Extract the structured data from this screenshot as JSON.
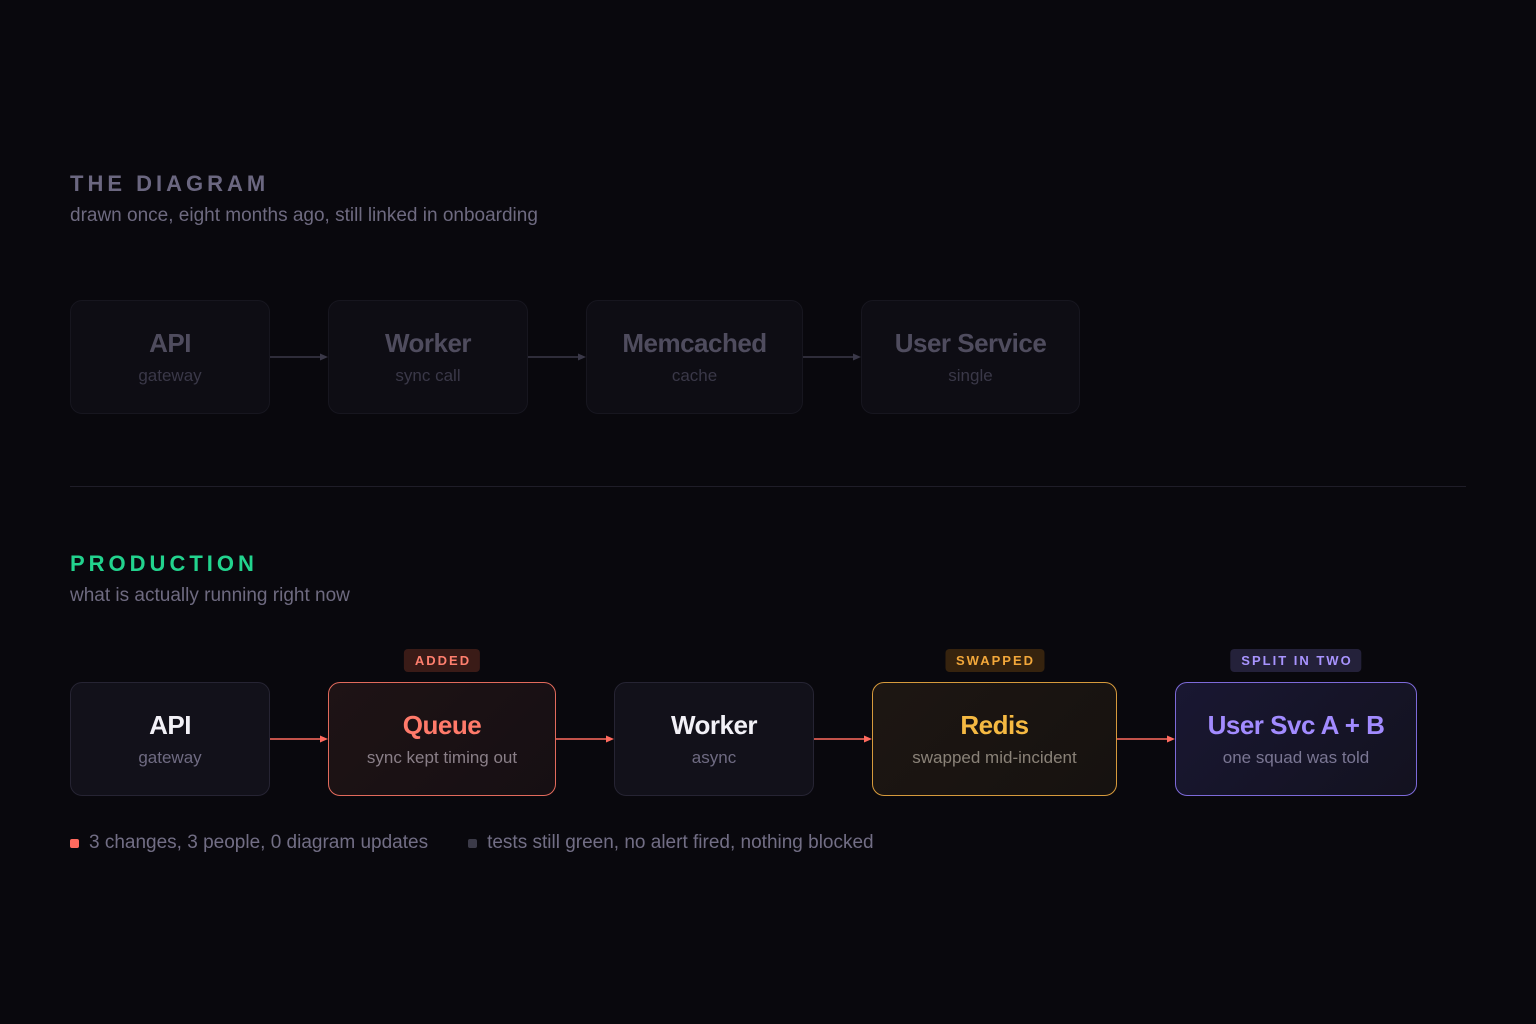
{
  "colors": {
    "background": "#09080d",
    "added": "#ff7a6a",
    "swapped": "#f5b942",
    "split": "#a28bff",
    "production_heading": "#22d38e",
    "arrow_old": "#3a3848",
    "arrow_new": "#ff6a5e"
  },
  "diagram": {
    "heading": "THE DIAGRAM",
    "subtitle": "drawn once, eight months ago, still linked in onboarding",
    "nodes": [
      {
        "title": "API",
        "desc": "gateway"
      },
      {
        "title": "Worker",
        "desc": "sync call"
      },
      {
        "title": "Memcached",
        "desc": "cache"
      },
      {
        "title": "User Service",
        "desc": "single"
      }
    ]
  },
  "production": {
    "heading": "PRODUCTION",
    "subtitle": "what is actually running right now",
    "nodes": [
      {
        "title": "API",
        "desc": "gateway"
      },
      {
        "title": "Queue",
        "desc": "sync kept timing out",
        "tag": "ADDED"
      },
      {
        "title": "Worker",
        "desc": "async"
      },
      {
        "title": "Redis",
        "desc": "swapped mid-incident",
        "tag": "SWAPPED"
      },
      {
        "title": "User Svc A + B",
        "desc": "one squad was told",
        "tag": "SPLIT IN TWO"
      }
    ]
  },
  "legend": [
    {
      "text": "3 changes, 3 people, 0 diagram updates",
      "icon": "red-square-icon"
    },
    {
      "text": "tests still green, no alert fired, nothing blocked",
      "icon": "grey-square-icon"
    }
  ]
}
